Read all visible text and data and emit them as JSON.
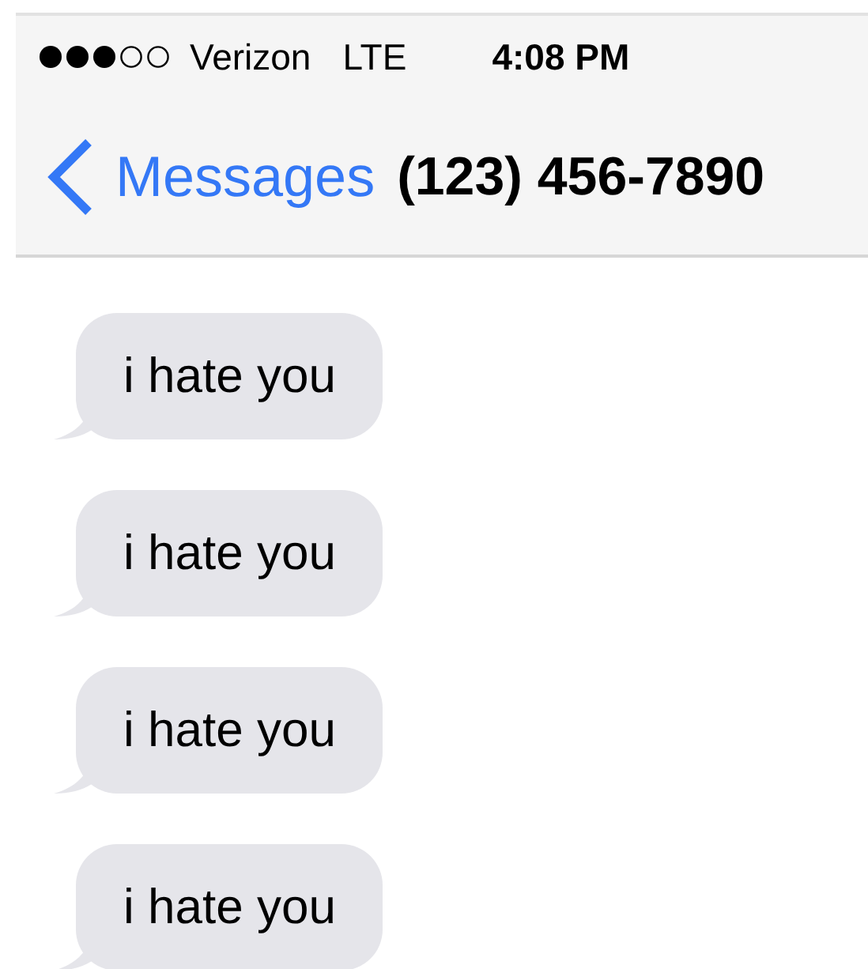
{
  "status_bar": {
    "carrier": "Verizon",
    "network": "LTE",
    "time": "4:08 PM"
  },
  "nav": {
    "back_label": "Messages",
    "title": "(123) 456-7890"
  },
  "messages": [
    {
      "text": "i hate you"
    },
    {
      "text": "i hate you"
    },
    {
      "text": "i hate you"
    },
    {
      "text": "i hate you"
    }
  ]
}
